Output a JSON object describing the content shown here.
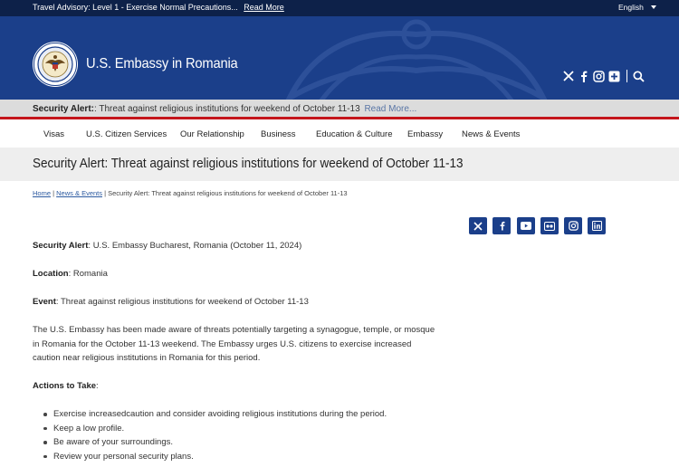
{
  "topbar": {
    "advisory_text": "Travel Advisory: Level 1 - Exercise Normal Precautions...",
    "advisory_link": "Read More",
    "language": "English"
  },
  "header": {
    "site_title": "U.S. Embassy in Romania",
    "social_icons": [
      "x-icon",
      "facebook-icon",
      "instagram-icon",
      "flickr-icon",
      "search-icon"
    ]
  },
  "alert": {
    "label": "Security Alert:",
    "text": ": Threat against religious institutions for weekend of October 11-13",
    "more": "Read More..."
  },
  "nav": {
    "items": [
      "Visas",
      "U.S. Citizen Services",
      "Our Relationship",
      "Business",
      "Education & Culture",
      "Embassy",
      "News & Events"
    ]
  },
  "page": {
    "title": "Security Alert: Threat against religious institutions for weekend of October 11-13"
  },
  "breadcrumb": {
    "home": "Home",
    "sep1": " | ",
    "section": "News & Events",
    "sep2": " | ",
    "current": "Security Alert: Threat against religious institutions for weekend of October 11-13"
  },
  "share": {
    "icons": [
      "x-icon",
      "facebook-icon",
      "youtube-icon",
      "flickr-icon",
      "instagram-icon",
      "linkedin-icon"
    ]
  },
  "content": {
    "p1_label": "Security Alert",
    "p1_text": ": U.S. Embassy Bucharest, Romania (October 11, 2024)",
    "p2_label": "Location",
    "p2_text": ": Romania",
    "p3_label": "Event",
    "p3_text": ": Threat against religious institutions for weekend of October 11-13",
    "body_line1": "The U.S. Embassy has been made aware of threats potentially targeting a synagogue, temple, or mosque",
    "body_line2": "in Romania for the October 11-13 weekend. The Embassy urges U.S. citizens to exercise increased",
    "body_line3": "caution near religious institutions in Romania for this period.",
    "actions_label": "Actions to Take",
    "actions_colon": ":",
    "actions": [
      "Exercise increasedcaution and consider avoiding religious institutions during the period.",
      "Keep a low profile.",
      "Be aware of your surroundings.",
      "Review your personal security plans."
    ]
  }
}
